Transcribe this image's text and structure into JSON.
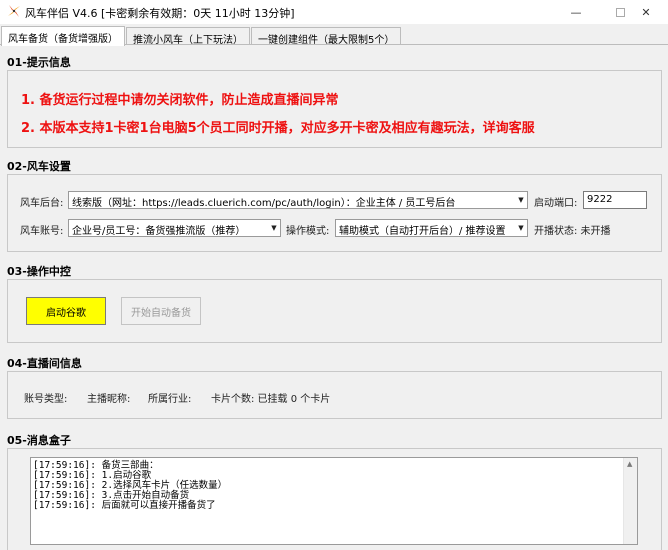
{
  "window": {
    "title": "风车伴侣 V4.6  [卡密剩余有效期：0天 11小时 13分钟]",
    "minimize": "—",
    "close": "✕"
  },
  "tabs": [
    {
      "label": "风车备货（备货增强版）",
      "active": true
    },
    {
      "label": "推流小风车（上下玩法）",
      "active": false
    },
    {
      "label": "一键创建组件（最大限制5个）",
      "active": false
    }
  ],
  "tips": {
    "title": "01-提示信息",
    "lines": [
      "1. 备货运行过程中请勿关闭软件，防止造成直播间异常",
      "2. 本版本支持1卡密1台电脑5个员工同时开播，对应多开卡密及相应有趣玩法，详询客服"
    ]
  },
  "settings": {
    "title": "02-风车设置",
    "backend_label": "风车后台:",
    "backend_value": "线索版（网址：https://leads.cluerich.com/pc/auth/login）：企业主体 / 员工号后台",
    "port_label": "启动端口:",
    "port_value": "9222",
    "account_label": "风车账号:",
    "account_value": "企业号/员工号：备货强推流版（推荐）",
    "mode_label": "操作模式:",
    "mode_value": "辅助模式（自动打开后台）/ 推荐设置",
    "live_status": "开播状态: 未开播"
  },
  "control": {
    "title": "03-操作中控",
    "start_button": "启动谷歌",
    "auto_button": "开始自动备货"
  },
  "room": {
    "title": "04-直播间信息",
    "account_type": "账号类型:",
    "host_name": "主播昵称:",
    "industry": "所属行业:",
    "card_count": "卡片个数: 已挂载 0 个卡片"
  },
  "messages": {
    "title": "05-消息盒子",
    "log": [
      "[17:59:16]: 备货三部曲：",
      "[17:59:16]: 1.启动谷歌",
      "[17:59:16]: 2.选择风车卡片（任选数量）",
      "[17:59:16]: 3.点击开始自动备货",
      "[17:59:16]: 后面就可以直接开播备货了"
    ]
  },
  "colors": {
    "warning": "#ee1111",
    "start_button": "#ffff00",
    "background": "#f0f0f0"
  },
  "icons": [
    "windmill-icon",
    "minimize-icon",
    "maximize-icon",
    "close-icon",
    "chevron-down-icon",
    "scroll-up-icon"
  ]
}
